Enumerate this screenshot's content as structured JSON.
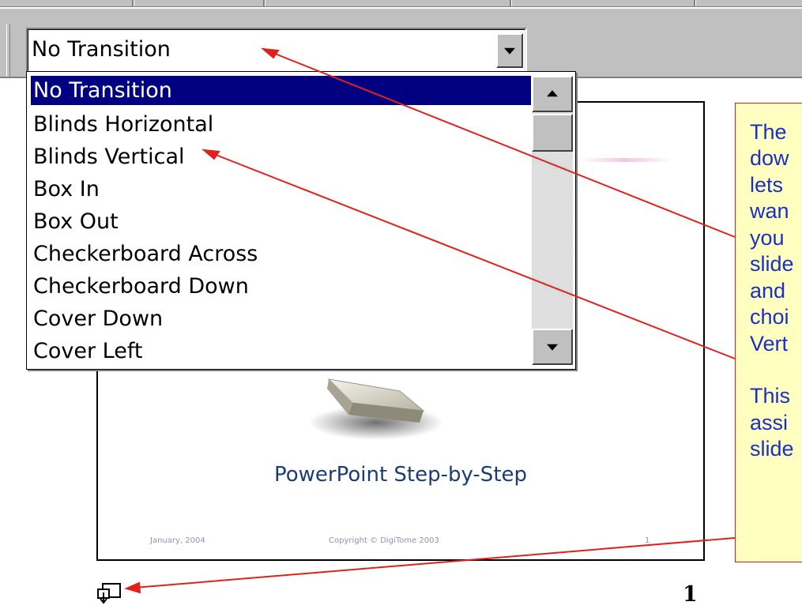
{
  "transition_select": {
    "selected_value": "No Transition",
    "options": [
      "No Transition",
      "Blinds Horizontal",
      "Blinds Vertical",
      "Box In",
      "Box Out",
      "Checkerboard Across",
      "Checkerboard Down",
      "Cover Down",
      "Cover Left"
    ],
    "scroll": {
      "up_icon": "scroll-up-icon",
      "down_icon": "scroll-down-icon"
    }
  },
  "slide": {
    "title": "PowerPoint Step-by-Step",
    "footer_date": "January, 2004",
    "footer_copyright": "Copyright © DigiTome 2003",
    "footer_page": "1"
  },
  "callout": {
    "lines_1": [
      "The",
      "dow",
      "lets",
      "wan",
      "you",
      "slide",
      "and",
      "choi",
      "Vert"
    ],
    "lines_2": [
      "This",
      "assi",
      "slide"
    ]
  },
  "slide_sorter": {
    "transition_icon": "slide-transition-icon",
    "slide_number": "1"
  },
  "colors": {
    "selection": "#000080",
    "callout_bg": "#ffffc0",
    "callout_text": "#1a2fc4",
    "arrow": "#e2201c",
    "slide_title": "#1c3c74"
  }
}
